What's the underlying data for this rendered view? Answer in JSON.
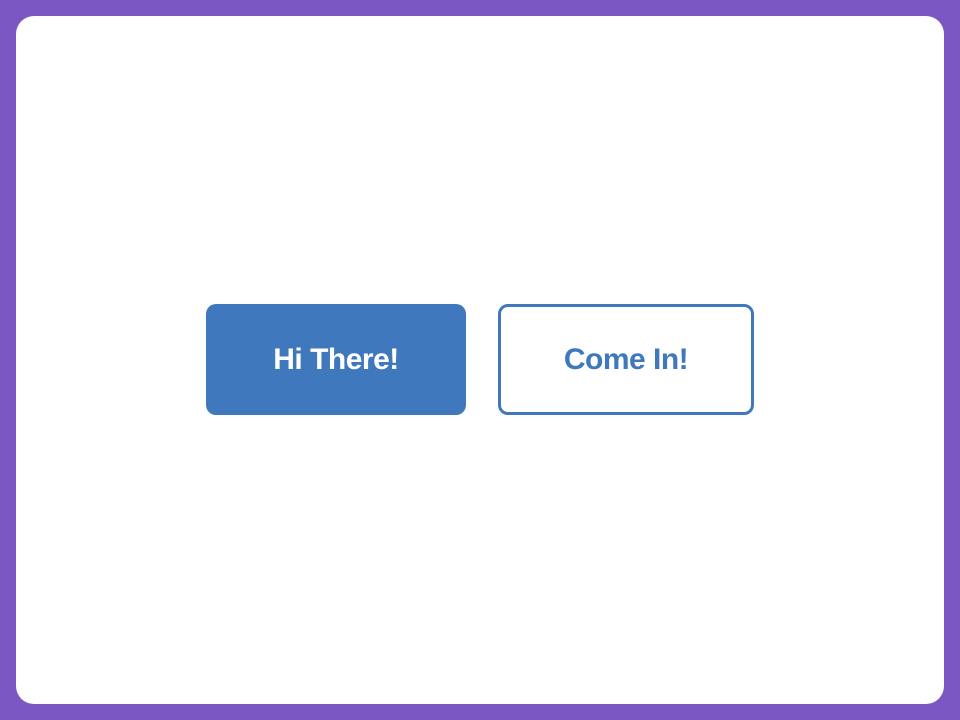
{
  "colors": {
    "frame": "#7b57c4",
    "panel": "#ffffff",
    "accent": "#3f78bd"
  },
  "buttons": {
    "primary_label": "Hi There!",
    "secondary_label": "Come In!"
  }
}
